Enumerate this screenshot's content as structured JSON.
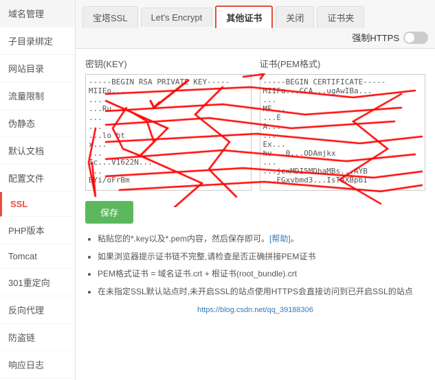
{
  "sidebar": {
    "items": [
      {
        "label": "域名管理",
        "id": "domain"
      },
      {
        "label": "子目录绑定",
        "id": "subdir"
      },
      {
        "label": "网站目录",
        "id": "webdir"
      },
      {
        "label": "流量限制",
        "id": "traffic"
      },
      {
        "label": "伪静态",
        "id": "rewrite"
      },
      {
        "label": "默认文档",
        "id": "default-doc"
      },
      {
        "label": "配置文件",
        "id": "config"
      },
      {
        "label": "SSL",
        "id": "ssl",
        "active": true
      },
      {
        "label": "PHP版本",
        "id": "php"
      },
      {
        "label": "Tomcat",
        "id": "tomcat"
      },
      {
        "label": "301重定向",
        "id": "redirect"
      },
      {
        "label": "反向代理",
        "id": "proxy"
      },
      {
        "label": "防盗链",
        "id": "hotlink"
      },
      {
        "label": "响应日志",
        "id": "log"
      }
    ]
  },
  "tabs": [
    {
      "label": "宝塔SSL",
      "id": "baota"
    },
    {
      "label": "Let's Encrypt",
      "id": "letsencrypt"
    },
    {
      "label": "其他证书",
      "id": "other",
      "active": true
    },
    {
      "label": "关闭",
      "id": "close"
    },
    {
      "label": "证书夹",
      "id": "certfolder"
    }
  ],
  "force_https": {
    "label": "强制HTTPS"
  },
  "key_label": "密钥(KEY)",
  "cert_label": "证书(PEM格式)",
  "key_placeholder": "-----BEGIN RSA PRIVATE KEY-----\n...\n-----END RSA PRIVATE KEY-----",
  "cert_placeholder": "-----BEGIN CERTIFICATE-----\nMIIFa...\n-----END CERTIFICATE-----",
  "key_content": "-----BEGIN RSA PRIVATE KEY-----\nMIIE...\n...\nBYi/oFrBm",
  "cert_content": "-----BEGIN CERTIFICATE-----\nMIIFa...\n...\n-----END CERTIFICATE-----",
  "save_button": "保存",
  "info_items": [
    "粘贴您的*.key以及*.pem内容，然后保存即可[帮助]。",
    "如果浏览器提示证书链不完整,请检查是否正确拼接PEM证书",
    "PEM格式证书 = 域名证书.crt + 根证书(root_bundle).crt",
    "在未指定SSL默认站点时,未开启SSL的站点使用HTTPS会直接访问到已开启SSL的站点"
  ],
  "help_link": "帮助",
  "watermark": "https://blog.csdn.net/qq_39188306"
}
